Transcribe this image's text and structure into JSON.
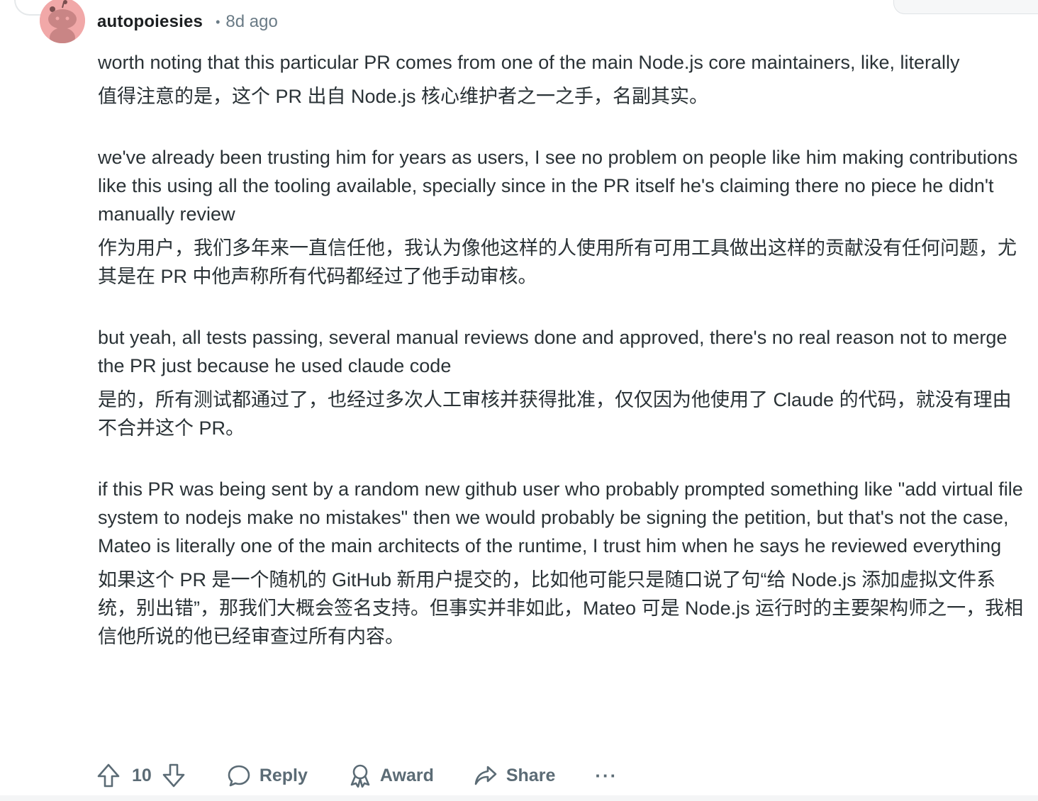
{
  "comment": {
    "author": "autopoiesies",
    "separator": "•",
    "time_ago": "8d ago",
    "paragraphs": [
      {
        "en": "worth noting that this particular PR comes from one of the main Node.js core maintainers, like, literally",
        "zh": "值得注意的是，这个 PR 出自 Node.js 核心维护者之一之手，名副其实。"
      },
      {
        "en": "we've already been trusting him for years as users, I see no problem on people like him making contributions like this using all the tooling available, specially since in the PR itself he's claiming there no piece he didn't manually review",
        "zh": "作为用户，我们多年来一直信任他，我认为像他这样的人使用所有可用工具做出这样的贡献没有任何问题，尤其是在 PR 中他声称所有代码都经过了他手动审核。"
      },
      {
        "en": "but yeah, all tests passing, several manual reviews done and approved, there's no real reason not to merge the PR just because he used claude code",
        "zh": "是的，所有测试都通过了，也经过多次人工审核并获得批准，仅仅因为他使用了 Claude 的代码，就没有理由不合并这个 PR。"
      },
      {
        "en": "if this PR was being sent by a random new github user who probably prompted something like \"add virtual file system to nodejs make no mistakes\" then we would probably be signing the petition, but that's not the case, Mateo is literally one of the main architects of the runtime, I trust him when he says he reviewed everything",
        "zh": "如果这个 PR 是一个随机的 GitHub 新用户提交的，比如他可能只是随口说了句“给 Node.js 添加虚拟文件系统，别出错”，那我们大概会签名支持。但事实并非如此，Mateo 可是 Node.js 运行时的主要架构师之一，我相信他所说的他已经审查过所有内容。"
      }
    ],
    "actions": {
      "vote_count": "10",
      "reply": "Reply",
      "award": "Award",
      "share": "Share",
      "more": "···"
    }
  },
  "icons": {
    "avatar": "reddit-snoo-avatar",
    "upvote": "upvote-arrow-icon",
    "downvote": "downvote-arrow-icon",
    "reply": "speech-bubble-icon",
    "award": "award-ribbon-icon",
    "share": "share-arrow-icon"
  },
  "colors": {
    "avatar_bg": "#f1a8a8",
    "text": "#2a3236",
    "muted": "#6a7b86",
    "action": "#5b6b75"
  }
}
